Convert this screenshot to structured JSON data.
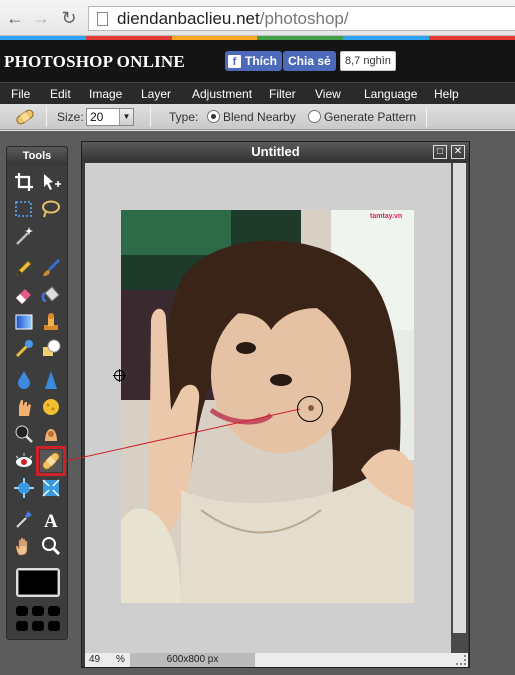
{
  "browser": {
    "back_icon": "back-arrow-icon",
    "forward_icon": "forward-arrow-icon",
    "reload_icon": "reload-icon",
    "url_domain": "diendanbaclieu.net",
    "url_path": "/photoshop/"
  },
  "header": {
    "title": "PHOTOSHOP ONLINE",
    "fb_like": "Thích",
    "fb_share": "Chia sẻ",
    "fb_count": "8,7 nghìn",
    "accent_colors": [
      "#2ea3f2",
      "#e53935",
      "#f9a825",
      "#43a047",
      "#2ea3f2",
      "#e53935"
    ]
  },
  "menu": [
    "File",
    "Edit",
    "Image",
    "Layer",
    "Adjustment",
    "Filter",
    "View",
    "Language",
    "Help"
  ],
  "options": {
    "size_label": "Size:",
    "size_value": "20",
    "type_label": "Type:",
    "blend_nearby": "Blend Nearby",
    "generate_pattern": "Generate Pattern",
    "selected_type": "Blend Nearby"
  },
  "tools_panel": {
    "title": "Tools",
    "selected_tool": "spot-heal",
    "foreground_color": "#000000"
  },
  "document": {
    "title": "Untitled",
    "zoom": "49",
    "zoom_unit": "%",
    "dimensions": "600x800 px",
    "watermark": "tamtay.vn"
  },
  "colors": {
    "annotation_red": "#d0202a",
    "workspace_bg": "#5c5c5c",
    "canvas_bg": "#cfcfcf"
  }
}
